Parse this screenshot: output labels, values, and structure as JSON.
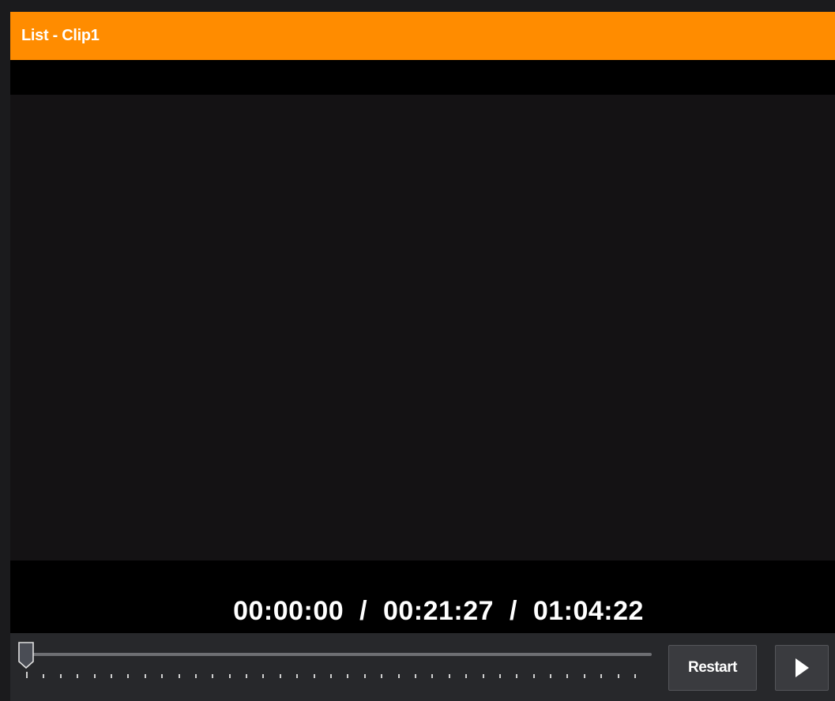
{
  "window": {
    "title": "List - Clip1"
  },
  "player": {
    "timecode": {
      "current": "00:00:00",
      "separator": "/",
      "duration": "00:21:27",
      "end": "01:04:22"
    },
    "position_fraction": 0.0,
    "tick_count": 37
  },
  "controls": {
    "restart_label": "Restart",
    "play_icon": "play-icon"
  },
  "colors": {
    "title_bar": "#ff8c00",
    "background": "#1b1b1d",
    "video_frame": "#141214",
    "controls_panel": "#27282b",
    "button": "#3a3b3f"
  }
}
